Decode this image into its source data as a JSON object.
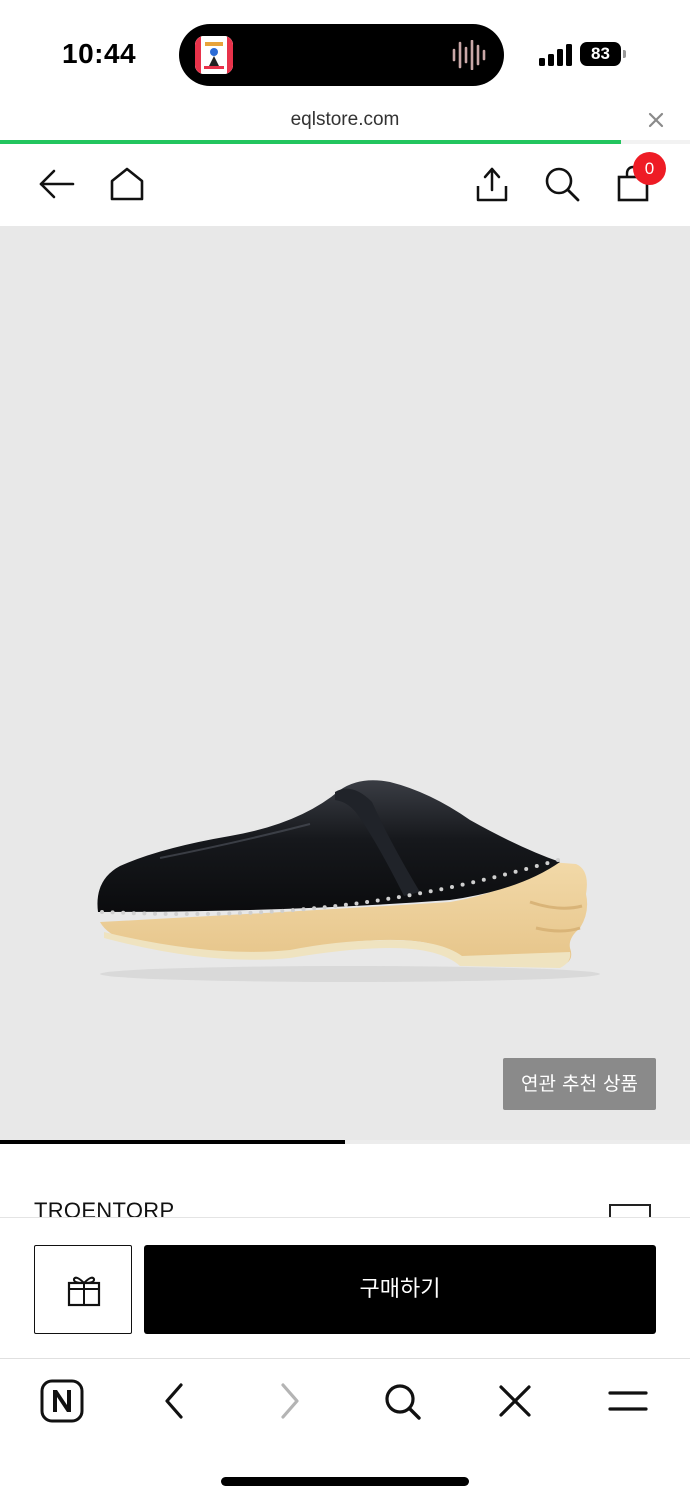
{
  "status_bar": {
    "time": "10:44",
    "battery_level": "83",
    "signal_icon": "cellular-signal-icon",
    "island_activity_icon": "audio-waveform-icon"
  },
  "url_bar": {
    "domain": "eqlstore.com",
    "close_icon": "close-icon",
    "load_progress": 0.9
  },
  "site_header": {
    "back_icon": "arrow-left-icon",
    "home_icon": "home-icon",
    "share_icon": "share-icon",
    "search_icon": "search-icon",
    "cart_icon": "shopping-bag-icon",
    "cart_count": "0"
  },
  "product": {
    "image_icon": "black-leather-clog-image",
    "related_button_label": "연관 추천 상품",
    "image_slide_progress": 0.5,
    "brand": "TROENTORP"
  },
  "action_bar": {
    "gift_icon": "gift-icon",
    "buy_label": "구매하기"
  },
  "browser_toolbar": {
    "items": [
      "naver-app-icon",
      "chevron-left-icon",
      "chevron-right-icon",
      "search-icon",
      "close-icon",
      "menu-icon"
    ]
  },
  "colors": {
    "progress": "#22c55e",
    "badge": "#ee1c25",
    "hero_background": "#e8e8e8",
    "buy_button": "#000000",
    "related_button": "#8a8a8a"
  }
}
